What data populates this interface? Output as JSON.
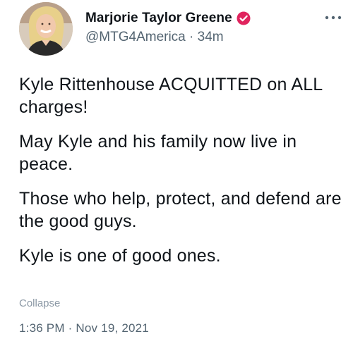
{
  "author": {
    "display_name": "Marjorie Taylor Greene",
    "handle": "@MTG4America",
    "separator": "·",
    "relative_time": "34m",
    "verified_badge_color": "#e0245e"
  },
  "tweet": {
    "paragraphs": [
      "Kyle Rittenhouse ACQUITTED on ALL charges!",
      "May Kyle and his family now live in peace.",
      "Those who help, protect, and defend are the good guys.",
      "Kyle is one of good ones."
    ],
    "collapse_label": "Collapse",
    "timestamp": "1:36 PM · Nov 19, 2021"
  },
  "icons": {
    "avatar": "profile-photo",
    "badge": "verified-check-icon",
    "more": "more-options-icon"
  }
}
